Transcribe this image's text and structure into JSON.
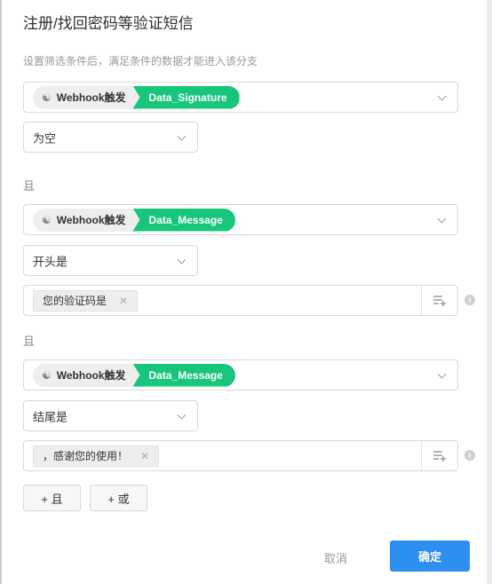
{
  "dialog": {
    "title": "注册/找回密码等验证短信",
    "description": "设置筛选条件后，满足条件的数据才能进入该分支"
  },
  "conditions": [
    {
      "source": "Webhook触发",
      "field": "Data_Signature",
      "operator": "为空"
    },
    {
      "connector": "且",
      "source": "Webhook触发",
      "field": "Data_Message",
      "operator": "开头是",
      "tag": "您的验证码是"
    },
    {
      "connector": "且",
      "source": "Webhook触发",
      "field": "Data_Message",
      "operator": "结尾是",
      "tag": "，感谢您的使用！"
    }
  ],
  "buttons": {
    "add_and": "+ 且",
    "add_or": "+ 或",
    "cancel": "取消",
    "confirm": "确定"
  },
  "icons": {
    "source": "webhook-icon",
    "dropdown": "chevron-down-icon",
    "remove": "close-icon",
    "add_value": "list-add-icon",
    "info": "info-icon"
  },
  "colors": {
    "field_pill": "#17c67a",
    "primary": "#2d8ff0"
  }
}
